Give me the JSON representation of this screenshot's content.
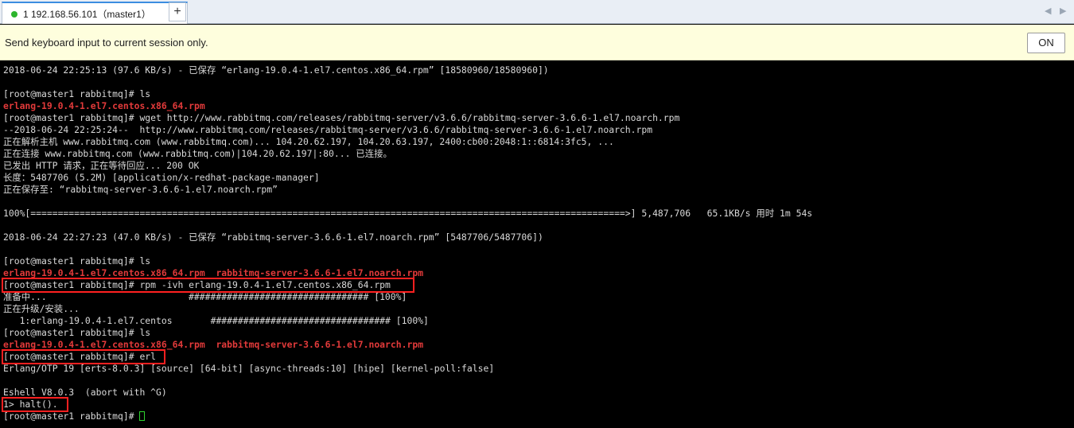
{
  "tab": {
    "title": "1 192.168.56.101（master1）",
    "close": "×",
    "new_tab": "+"
  },
  "scroll": {
    "left": "◀",
    "right": "▶"
  },
  "notice": {
    "message": "Send keyboard input to current session only.",
    "button": "ON"
  },
  "colors": {
    "prompt": "#d9d9d9",
    "highlight_file": "#e23a3a",
    "annotation_box": "#ff2020",
    "session_dot": "#2db52d"
  },
  "terminal": {
    "lines": [
      "2018-06-24 22:25:13 (97.6 KB/s) - 已保存 “erlang-19.0.4-1.el7.centos.x86_64.rpm” [18580960/18580960])",
      "",
      "[root@master1 rabbitmq]# ls",
      "erlang-19.0.4-1.el7.centos.x86_64.rpm",
      "[root@master1 rabbitmq]# wget http://www.rabbitmq.com/releases/rabbitmq-server/v3.6.6/rabbitmq-server-3.6.6-1.el7.noarch.rpm",
      "--2018-06-24 22:25:24--  http://www.rabbitmq.com/releases/rabbitmq-server/v3.6.6/rabbitmq-server-3.6.6-1.el7.noarch.rpm",
      "正在解析主机 www.rabbitmq.com (www.rabbitmq.com)... 104.20.62.197, 104.20.63.197, 2400:cb00:2048:1::6814:3fc5, ...",
      "正在连接 www.rabbitmq.com (www.rabbitmq.com)|104.20.62.197|:80... 已连接。",
      "已发出 HTTP 请求，正在等待回应... 200 OK",
      "长度：5487706 (5.2M) [application/x-redhat-package-manager]",
      "正在保存至: “rabbitmq-server-3.6.6-1.el7.noarch.rpm”",
      "",
      "100%[=============================================================================================================>] 5,487,706   65.1KB/s 用时 1m 54s",
      "",
      "2018-06-24 22:27:23 (47.0 KB/s) - 已保存 “rabbitmq-server-3.6.6-1.el7.noarch.rpm” [5487706/5487706])",
      "",
      "[root@master1 rabbitmq]# ls",
      "erlang-19.0.4-1.el7.centos.x86_64.rpm  rabbitmq-server-3.6.6-1.el7.noarch.rpm",
      "[root@master1 rabbitmq]# rpm -ivh erlang-19.0.4-1.el7.centos.x86_64.rpm",
      "准备中...                          ################################# [100%]",
      "正在升级/安装...",
      "   1:erlang-19.0.4-1.el7.centos       ################################# [100%]",
      "[root@master1 rabbitmq]# ls",
      "erlang-19.0.4-1.el7.centos.x86_64.rpm  rabbitmq-server-3.6.6-1.el7.noarch.rpm",
      "[root@master1 rabbitmq]# erl",
      "Erlang/OTP 19 [erts-8.0.3] [source] [64-bit] [async-threads:10] [hipe] [kernel-poll:false]",
      "",
      "Eshell V8.0.3  (abort with ^G)",
      "1> halt().",
      "[root@master1 rabbitmq]# "
    ]
  }
}
